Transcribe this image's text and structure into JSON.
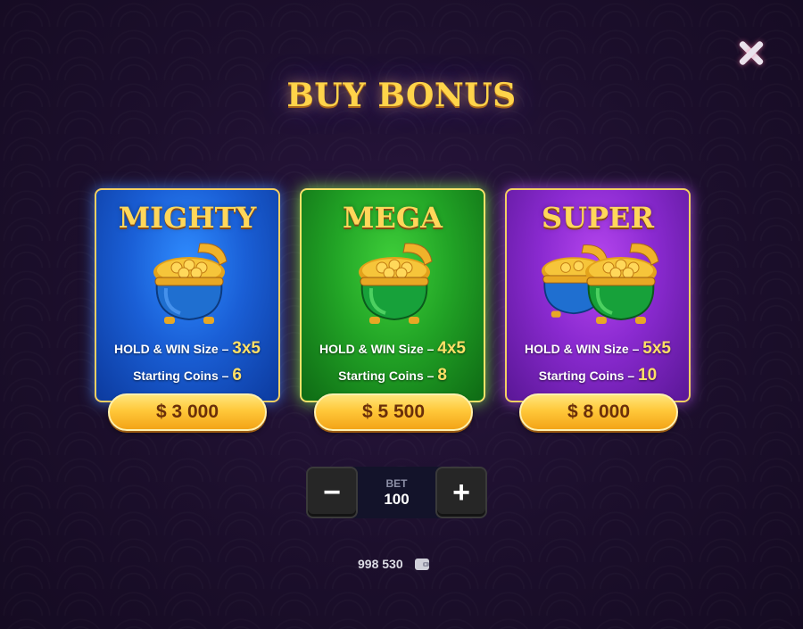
{
  "title": "BUY BONUS",
  "cards": [
    {
      "name": "MIGHTY",
      "size_label": "HOLD & WIN Size –",
      "size_value": "3x5",
      "coins_label": "Starting Coins –",
      "coins_value": "6",
      "price": "$ 3 000",
      "color": "#1a5fd6"
    },
    {
      "name": "MEGA",
      "size_label": "HOLD & WIN Size –",
      "size_value": "4x5",
      "coins_label": "Starting Coins –",
      "coins_value": "8",
      "price": "$ 5 500",
      "color": "#22a426"
    },
    {
      "name": "SUPER",
      "size_label": "HOLD & WIN Size –",
      "size_value": "5x5",
      "coins_label": "Starting Coins –",
      "coins_value": "10",
      "price": "$ 8 000",
      "color": "#8a2ad0"
    }
  ],
  "bet": {
    "label": "BET",
    "value": "100",
    "minus": "−",
    "plus": "+"
  },
  "balance": "998 530",
  "icons": {
    "close": "close-icon",
    "wallet": "wallet-icon",
    "pot": "pot-of-gold-icon"
  },
  "colors": {
    "gold": "#ffd44a",
    "price_text": "#6a2f0a"
  }
}
